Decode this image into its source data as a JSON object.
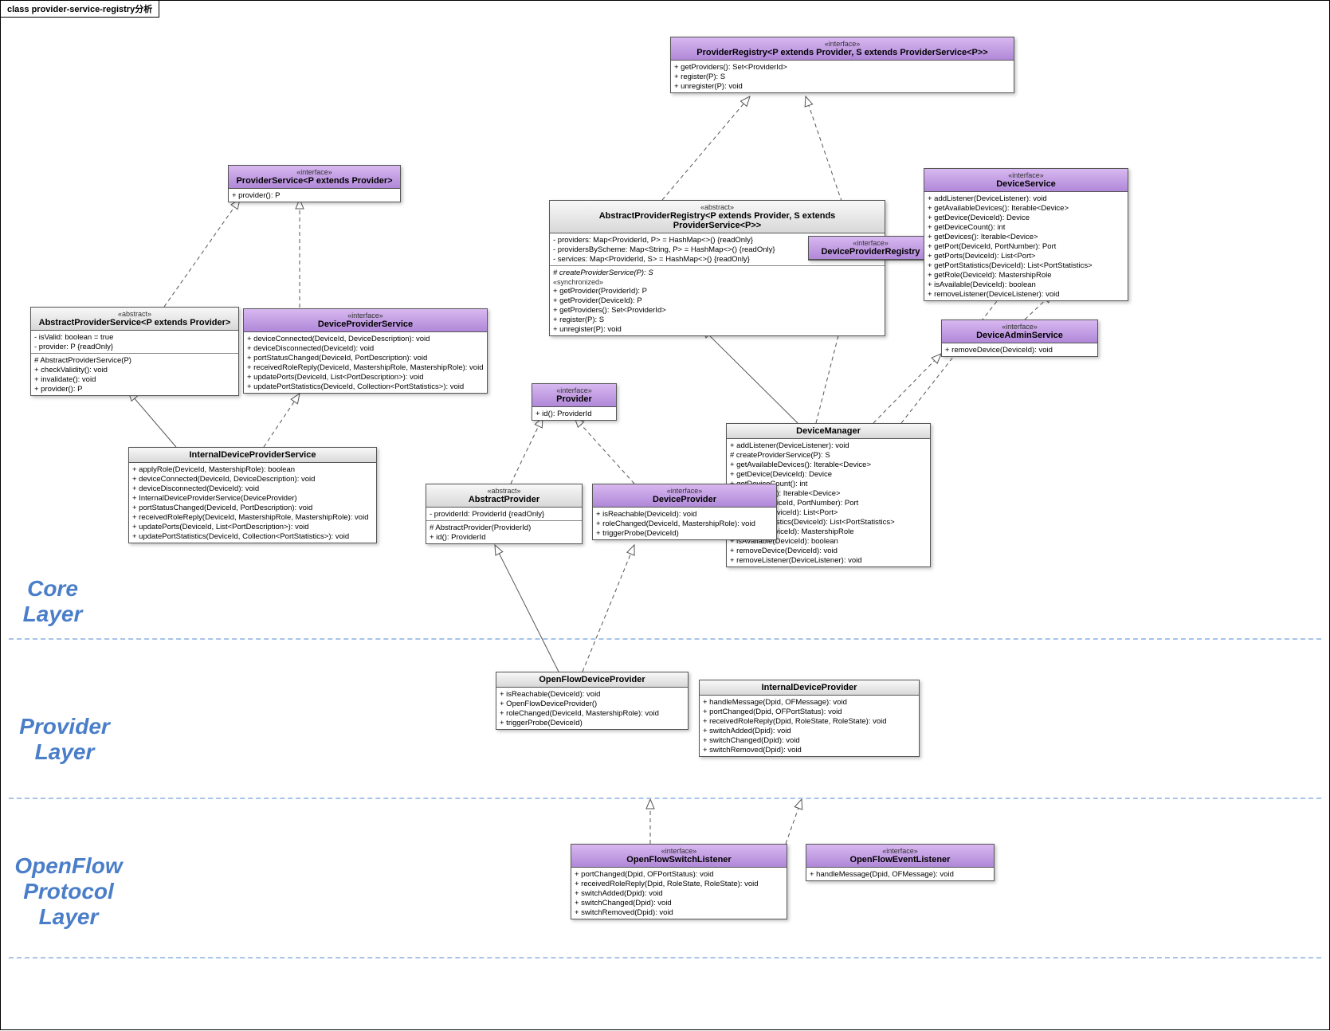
{
  "diagramTitle": "class provider-service-registry分析",
  "layers": {
    "core": "Core Layer",
    "provider": "Provider Layer",
    "openflow": "OpenFlow Protocol Layer"
  },
  "providerRegistry": {
    "stereo": "«interface»",
    "name": "ProviderRegistry<P extends Provider, S extends ProviderService<P>>",
    "m1": "+  getProviders(): Set<ProviderId>",
    "m2": "+  register(P): S",
    "m3": "+  unregister(P): void"
  },
  "providerService": {
    "stereo": "«interface»",
    "name": "ProviderService<P extends Provider>",
    "m1": "+  provider(): P"
  },
  "abstractProviderRegistry": {
    "stereo": "«abstract»",
    "name": "AbstractProviderRegistry<P extends Provider, S extends ProviderService<P>>",
    "a1": "-   providers: Map<ProviderId, P> = HashMap<>() {readOnly}",
    "a2": "-   providersByScheme: Map<String, P> = HashMap<>() {readOnly}",
    "a3": "-   services: Map<ProviderId, S> = HashMap<>() {readOnly}",
    "m1": "#  createProviderService(P): S",
    "sync": "«synchronized»",
    "m2": "+  getProvider(ProviderId): P",
    "m3": "+  getProvider(DeviceId): P",
    "m4": "+  getProviders(): Set<ProviderId>",
    "m5": "+  register(P): S",
    "m6": "+  unregister(P): void"
  },
  "deviceProviderRegistry": {
    "stereo": "«interface»",
    "name": "DeviceProviderRegistry"
  },
  "deviceService": {
    "stereo": "«interface»",
    "name": "DeviceService",
    "m1": "+  addListener(DeviceListener): void",
    "m2": "+  getAvailableDevices(): Iterable<Device>",
    "m3": "+  getDevice(DeviceId): Device",
    "m4": "+  getDeviceCount(): int",
    "m5": "+  getDevices(): Iterable<Device>",
    "m6": "+  getPort(DeviceId, PortNumber): Port",
    "m7": "+  getPorts(DeviceId): List<Port>",
    "m8": "+  getPortStatistics(DeviceId): List<PortStatistics>",
    "m9": "+  getRole(DeviceId): MastershipRole",
    "m10": "+  isAvailable(DeviceId): boolean",
    "m11": "+  removeListener(DeviceListener): void"
  },
  "deviceAdminService": {
    "stereo": "«interface»",
    "name": "DeviceAdminService",
    "m1": "+  removeDevice(DeviceId): void"
  },
  "abstractProviderService": {
    "stereo": "«abstract»",
    "name": "AbstractProviderService<P extends Provider>",
    "a1": "-   isValid: boolean = true",
    "a2": "-   provider: P {readOnly}",
    "m1": "#  AbstractProviderService(P)",
    "m2": "+  checkValidity(): void",
    "m3": "+  invalidate(): void",
    "m4": "+  provider(): P"
  },
  "deviceProviderService": {
    "stereo": "«interface»",
    "name": "DeviceProviderService",
    "m1": "+  deviceConnected(DeviceId, DeviceDescription): void",
    "m2": "+  deviceDisconnected(DeviceId): void",
    "m3": "+  portStatusChanged(DeviceId, PortDescription): void",
    "m4": "+  receivedRoleReply(DeviceId, MastershipRole, MastershipRole): void",
    "m5": "+  updatePorts(DeviceId, List<PortDescription>): void",
    "m6": "+  updatePortStatistics(DeviceId, Collection<PortStatistics>): void"
  },
  "provider": {
    "stereo": "«interface»",
    "name": "Provider",
    "m1": "+  id(): ProviderId"
  },
  "abstractProvider": {
    "stereo": "«abstract»",
    "name": "AbstractProvider",
    "a1": "-   providerId: ProviderId {readOnly}",
    "m1": "#  AbstractProvider(ProviderId)",
    "m2": "+  id(): ProviderId"
  },
  "deviceProvider": {
    "stereo": "«interface»",
    "name": "DeviceProvider",
    "m1": "+  isReachable(DeviceId): void",
    "m2": "+  roleChanged(DeviceId, MastershipRole): void",
    "m3": "+  triggerProbe(DeviceId)"
  },
  "deviceManager": {
    "name": "DeviceManager",
    "m1": "+  addListener(DeviceListener): void",
    "m2": "#  createProviderService(P): S",
    "m3": "+  getAvailableDevices(): Iterable<Device>",
    "m4": "+  getDevice(DeviceId): Device",
    "m5": "+  getDeviceCount(): int",
    "m6": "+  getDevices(): Iterable<Device>",
    "m7": "+  getPort(DeviceId, PortNumber): Port",
    "m8": "+  getPorts(DeviceId): List<Port>",
    "m9": "+  getPortStatistics(DeviceId): List<PortStatistics>",
    "m10": "+  getRole(DeviceId): MastershipRole",
    "m11": "+  isAvailable(DeviceId): boolean",
    "m12": "+  removeDevice(DeviceId): void",
    "m13": "+  removeListener(DeviceListener): void"
  },
  "internalDeviceProviderService": {
    "name": "InternalDeviceProviderService",
    "m1": "+  applyRole(DeviceId, MastershipRole): boolean",
    "m2": "+  deviceConnected(DeviceId, DeviceDescription): void",
    "m3": "+  deviceDisconnected(DeviceId): void",
    "m4": "+  InternalDeviceProviderService(DeviceProvider)",
    "m5": "+  portStatusChanged(DeviceId, PortDescription): void",
    "m6": "+  receivedRoleReply(DeviceId, MastershipRole, MastershipRole): void",
    "m7": "+  updatePorts(DeviceId, List<PortDescription>): void",
    "m8": "+  updatePortStatistics(DeviceId, Collection<PortStatistics>): void"
  },
  "openFlowDeviceProvider": {
    "name": "OpenFlowDeviceProvider",
    "m1": "+  isReachable(DeviceId): void",
    "m2": "+  OpenFlowDeviceProvider()",
    "m3": "+  roleChanged(DeviceId, MastershipRole): void",
    "m4": "+  triggerProbe(DeviceId)"
  },
  "internalDeviceProvider": {
    "name": "InternalDeviceProvider",
    "m1": "+  handleMessage(Dpid, OFMessage): void",
    "m2": "+  portChanged(Dpid, OFPortStatus): void",
    "m3": "+  receivedRoleReply(Dpid, RoleState, RoleState): void",
    "m4": "+  switchAdded(Dpid): void",
    "m5": "+  switchChanged(Dpid): void",
    "m6": "+  switchRemoved(Dpid): void"
  },
  "openFlowSwitchListener": {
    "stereo": "«interface»",
    "name": "OpenFlowSwitchListener",
    "m1": "+  portChanged(Dpid, OFPortStatus): void",
    "m2": "+  receivedRoleReply(Dpid, RoleState, RoleState): void",
    "m3": "+  switchAdded(Dpid): void",
    "m4": "+  switchChanged(Dpid): void",
    "m5": "+  switchRemoved(Dpid): void"
  },
  "openFlowEventListener": {
    "stereo": "«interface»",
    "name": "OpenFlowEventListener",
    "m1": "+  handleMessage(Dpid, OFMessage): void"
  }
}
